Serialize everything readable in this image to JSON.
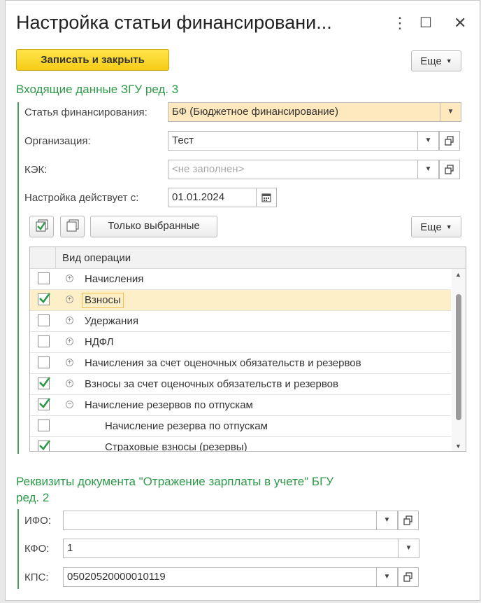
{
  "window": {
    "title": "Настройка статьи финансировани...",
    "more_icon": "⋮",
    "maximize_icon": "☐",
    "close_icon": "✕"
  },
  "toolbar": {
    "save_close": "Записать и закрыть",
    "more": "Еще"
  },
  "section1": {
    "title": "Входящие данные ЗГУ ред. 3",
    "fin_article_label": "Статья финансирования:",
    "fin_article_value": "БФ (Бюджетное финансирование)",
    "org_label": "Организация:",
    "org_value": "Тест",
    "kek_label": "КЭК:",
    "kek_placeholder": "<не заполнен>",
    "date_label": "Настройка действует с:",
    "date_value": "01.01.2024"
  },
  "grid_toolbar": {
    "only_selected": "Только выбранные",
    "more": "Еще"
  },
  "grid": {
    "column_header": "Вид операции",
    "rows": [
      {
        "label": "Начисления",
        "checked": false,
        "expander": "+",
        "level": 0
      },
      {
        "label": "Взносы",
        "checked": true,
        "expander": "+",
        "level": 0,
        "selected": true
      },
      {
        "label": "Удержания",
        "checked": false,
        "expander": "+",
        "level": 0
      },
      {
        "label": "НДФЛ",
        "checked": false,
        "expander": "+",
        "level": 0
      },
      {
        "label": "Начисления за счет оценочных обязательств и резервов",
        "checked": false,
        "expander": "+",
        "level": 0
      },
      {
        "label": "Взносы за счет оценочных обязательств и резервов",
        "checked": true,
        "expander": "+",
        "level": 0
      },
      {
        "label": "Начисление резервов по отпускам",
        "checked": true,
        "expander": "−",
        "level": 0
      },
      {
        "label": "Начисление резерва по отпускам",
        "checked": false,
        "expander": "",
        "level": 1
      },
      {
        "label": "Страховые взносы (резервы)",
        "checked": true,
        "expander": "",
        "level": 1
      }
    ]
  },
  "section2": {
    "title_line1": "Реквизиты документа \"Отражение зарплаты в учете\" БГУ",
    "title_line2": "ред. 2",
    "ifo_label": "ИФО:",
    "ifo_value": "",
    "kfo_label": "КФО:",
    "kfo_value": "1",
    "kps_label": "КПС:",
    "kps_value": "05020520000010119"
  }
}
